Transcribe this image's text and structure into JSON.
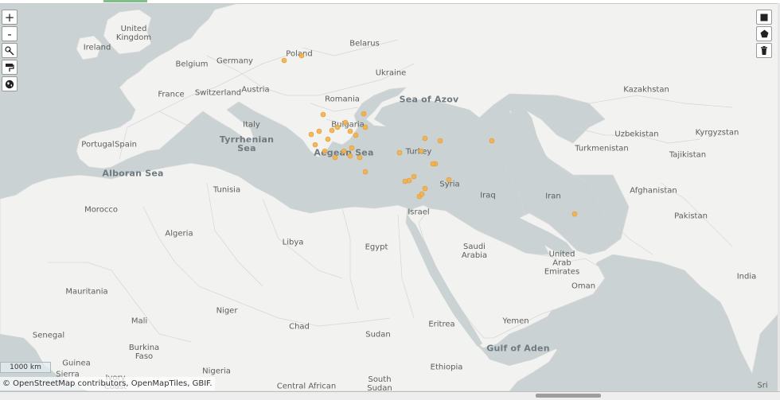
{
  "map": {
    "labels": {
      "countries": [
        "United Kingdom",
        "Ireland",
        "Belgium",
        "Germany",
        "Poland",
        "Belarus",
        "Ukraine",
        "France",
        "Switzerland",
        "Austria",
        "Romania",
        "Italy",
        "Bulgaria",
        "Portugal",
        "Spain",
        "Turkey",
        "Tunisia",
        "Morocco",
        "Algeria",
        "Libya",
        "Egypt",
        "Syria",
        "Iraq",
        "Iran",
        "Israel",
        "Saudi Arabia",
        "United Arab Emirates",
        "Oman",
        "Kazakhstan",
        "Uzbekistan",
        "Turkmenistan",
        "Kyrgyzstan",
        "Tajikistan",
        "Afghanistan",
        "Pakistan",
        "India",
        "Mauritania",
        "Mali",
        "Niger",
        "Chad",
        "Sudan",
        "Eritrea",
        "Yemen",
        "Senegal",
        "Burkina Faso",
        "Guinea",
        "Sierra",
        "Ivory Coast",
        "Nigeria",
        "Central African",
        "South Sudan",
        "Ethiopia",
        "Sri"
      ],
      "seas": [
        "Sea of Azov",
        "Tyrrhenian Sea",
        "Aegean Sea",
        "Alboran Sea",
        "Gulf of Aden"
      ]
    },
    "occurrence_points_count": 36,
    "point_color": "#f4b04a"
  },
  "controls": {
    "zoom_in": "+",
    "zoom_out": "-",
    "draw_square_icon": "square-icon",
    "draw_polygon_icon": "pentagon-icon",
    "delete_icon": "trash-icon",
    "select_icon": "cursor-select-icon",
    "paint_icon": "paint-roller-icon",
    "globe_icon": "globe-icon"
  },
  "scale": {
    "label": "1000 km"
  },
  "attribution": "© OpenStreetMap contributors, OpenMapTiles, GBIF."
}
